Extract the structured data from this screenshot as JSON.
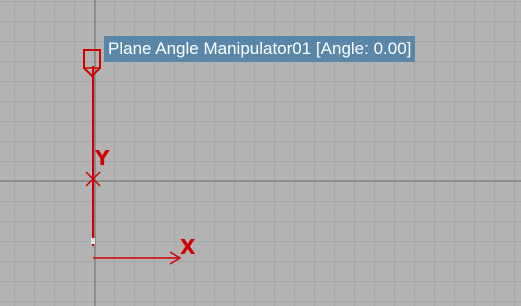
{
  "viewport": {
    "background_color": "#b3b3b3",
    "grid_color": "#a6a6a6",
    "major_axis_color": "#6e6e6e"
  },
  "tooltip": {
    "text": "Plane Angle Manipulator01 [Angle:  0.00]",
    "background_color": "#5a87a8",
    "text_color": "#ffffff"
  },
  "gizmo": {
    "color": "#d10000",
    "axis_y_label": "Y",
    "axis_x_label": "X",
    "handle_icon": "angle-handle-icon"
  }
}
